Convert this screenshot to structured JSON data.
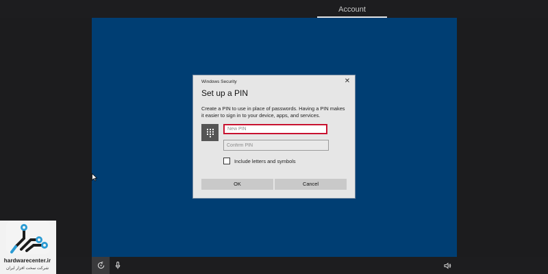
{
  "top_bar": {
    "account_tab": "Account"
  },
  "dialog": {
    "window_title": "Windows Security",
    "close_glyph": "✕",
    "heading": "Set up a PIN",
    "description": "Create a PIN to use in place of passwords. Having a PIN makes it easier to sign in to your device, apps, and services.",
    "new_pin": {
      "value": "",
      "placeholder": "New PIN"
    },
    "confirm_pin": {
      "value": "",
      "placeholder": "Confirm PIN"
    },
    "include_letters_label": "Include letters and symbols",
    "include_letters_checked": false,
    "ok_label": "OK",
    "cancel_label": "Cancel",
    "icons": [
      "keypad-icon",
      "close-icon"
    ]
  },
  "taskbar": {
    "icons": [
      "ease-of-access-icon",
      "microphone-icon",
      "volume-icon"
    ]
  },
  "watermark": {
    "name": "hardwarecenter.ir",
    "subtitle": "شرکت سخت افزار ایران"
  },
  "colors": {
    "screen_bg": "#003e73",
    "frame_bg": "#1d1d1f",
    "dialog_bg": "#e6e6e6",
    "focus_border": "#c8102e",
    "button_bg": "#c9c9c9",
    "brand_accent": "#2b9bd3"
  }
}
